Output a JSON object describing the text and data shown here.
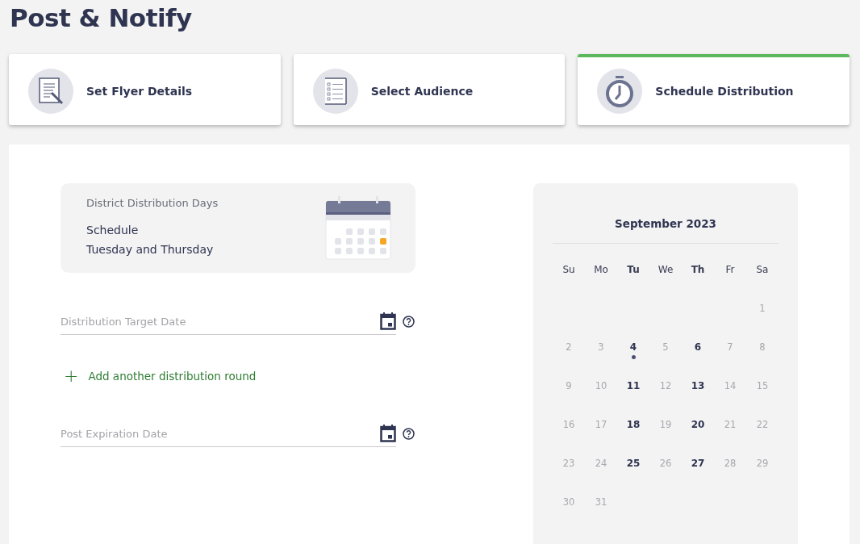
{
  "page_title": "Post & Notify",
  "steps": [
    {
      "kind": "flyer",
      "label": "Set Flyer Details",
      "selected": false
    },
    {
      "kind": "audience",
      "label": "Select Audience",
      "selected": false
    },
    {
      "kind": "clock",
      "label": "Schedule Distribution",
      "selected": true
    }
  ],
  "info_card": {
    "title": "District Distribution Days",
    "label": "Schedule",
    "value": "Tuesday and Thursday"
  },
  "fields": [
    {
      "kind": "date",
      "placeholder": "Distribution Target Date"
    },
    {
      "kind": "add",
      "label": "Add another distribution round",
      "icon": "+"
    },
    {
      "kind": "date",
      "placeholder": "Post Expiration Date"
    }
  ],
  "calendar": {
    "month": "September 2023",
    "weekdays": [
      {
        "label": "Su",
        "highlighted": false
      },
      {
        "label": "Mo",
        "highlighted": false
      },
      {
        "label": "Tu",
        "highlighted": true
      },
      {
        "label": "We",
        "highlighted": false
      },
      {
        "label": "Th",
        "highlighted": true
      },
      {
        "label": "Fr",
        "highlighted": false
      },
      {
        "label": "Sa",
        "highlighted": false
      }
    ],
    "weeks": [
      [
        {
          "label": "1",
          "available": false,
          "today": false
        }
      ],
      [
        {
          "label": "2",
          "available": false,
          "today": false
        },
        {
          "label": "3",
          "available": false,
          "today": false
        },
        {
          "label": "4",
          "available": true,
          "today": true
        },
        {
          "label": "5",
          "available": false,
          "today": false
        },
        {
          "label": "6",
          "available": true,
          "today": false
        },
        {
          "label": "7",
          "available": false,
          "today": false
        },
        {
          "label": "8",
          "available": false,
          "today": false
        }
      ],
      [
        {
          "label": "9",
          "available": false,
          "today": false
        },
        {
          "label": "10",
          "available": false,
          "today": false
        },
        {
          "label": "11",
          "available": true,
          "today": false
        },
        {
          "label": "12",
          "available": false,
          "today": false
        },
        {
          "label": "13",
          "available": true,
          "today": false
        },
        {
          "label": "14",
          "available": false,
          "today": false
        },
        {
          "label": "15",
          "available": false,
          "today": false
        }
      ],
      [
        {
          "label": "16",
          "available": false,
          "today": false
        },
        {
          "label": "17",
          "available": false,
          "today": false
        },
        {
          "label": "18",
          "available": true,
          "today": false
        },
        {
          "label": "19",
          "available": false,
          "today": false
        },
        {
          "label": "20",
          "available": true,
          "today": false
        },
        {
          "label": "21",
          "available": false,
          "today": false
        },
        {
          "label": "22",
          "available": false,
          "today": false
        }
      ],
      [
        {
          "label": "23",
          "available": false,
          "today": false
        },
        {
          "label": "24",
          "available": false,
          "today": false
        },
        {
          "label": "25",
          "available": true,
          "today": false
        },
        {
          "label": "26",
          "available": false,
          "today": false
        },
        {
          "label": "27",
          "available": true,
          "today": false
        },
        {
          "label": "28",
          "available": false,
          "today": false
        },
        {
          "label": "29",
          "available": false,
          "today": false
        }
      ],
      [
        {
          "label": "30",
          "available": false,
          "today": false
        },
        {
          "label": "31",
          "available": false,
          "today": false
        }
      ]
    ]
  }
}
